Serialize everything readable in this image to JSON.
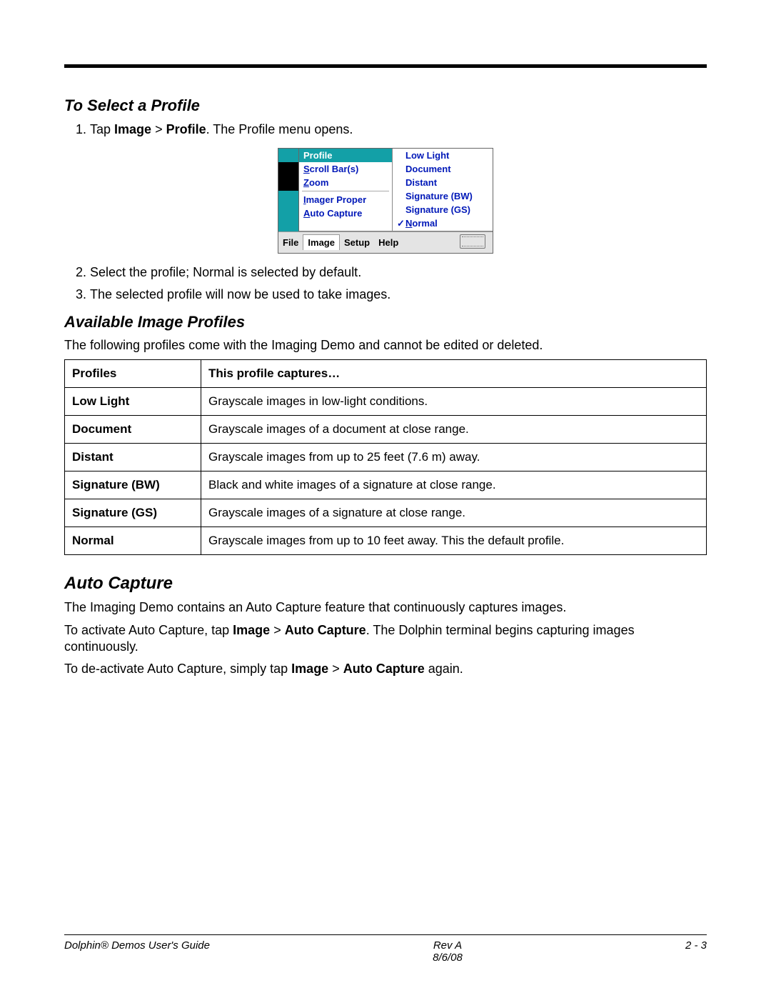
{
  "sections": {
    "select_profile": {
      "heading": "To Select a Profile",
      "step1_pre": "Tap ",
      "step1_b1": "Image",
      "step1_gt": " > ",
      "step1_b2": "Profile",
      "step1_post": ". The Profile menu opens.",
      "step2": "Select the profile; Normal is selected by default.",
      "step3": "The selected profile will now be used to take images."
    },
    "available_profiles": {
      "heading": "Available Image Profiles",
      "intro": "The following profiles come with the Imaging Demo and cannot be edited or deleted."
    },
    "auto_capture": {
      "heading": "Auto Capture",
      "p1": "The Imaging Demo contains an Auto Capture feature that continuously captures images.",
      "p2_a": "To activate Auto Capture, tap ",
      "p2_b1": "Image",
      "p2_gt": " > ",
      "p2_b2": "Auto Capture",
      "p2_c": ". The Dolphin terminal begins capturing images continuously.",
      "p3_a": "To de-activate Auto Capture, simply tap ",
      "p3_b1": "Image",
      "p3_gt": " > ",
      "p3_b2": "Auto Capture",
      "p3_c": " again."
    }
  },
  "screenshot": {
    "left_menu": {
      "header": "Profile",
      "items": [
        {
          "pre": "",
          "ul": "S",
          "post": "croll Bar(s)"
        },
        {
          "pre": "",
          "ul": "Z",
          "post": "oom"
        }
      ],
      "items2": [
        {
          "pre": "",
          "ul": "I",
          "post": "mager Proper"
        },
        {
          "pre": "",
          "ul": "A",
          "post": "uto Capture"
        }
      ]
    },
    "right_menu": {
      "items": [
        {
          "label": "Low Light",
          "checked": false
        },
        {
          "label": "Document",
          "checked": false
        },
        {
          "label": "Distant",
          "checked": false
        },
        {
          "label": "Signature (BW)",
          "checked": false
        },
        {
          "label": "Signature (GS)",
          "checked": false
        }
      ],
      "normal_pre": "",
      "normal_ul": "N",
      "normal_post": "ormal"
    },
    "taskbar": {
      "file": "File",
      "image": "Image",
      "setup": "Setup",
      "help": "Help"
    }
  },
  "table": {
    "h1": "Profiles",
    "h2": "This profile captures…",
    "rows": [
      {
        "name": "Low Light",
        "desc": "Grayscale images in low-light conditions."
      },
      {
        "name": "Document",
        "desc": "Grayscale images of a document at close range."
      },
      {
        "name": "Distant",
        "desc": "Grayscale images from up to 25 feet (7.6 m) away."
      },
      {
        "name": "Signature (BW)",
        "desc": "Black and white images of a signature at close range."
      },
      {
        "name": "Signature (GS)",
        "desc": "Grayscale images of a signature at close range."
      },
      {
        "name": "Normal",
        "desc": "Grayscale images from up to 10 feet away. This the default profile."
      }
    ]
  },
  "footer": {
    "left": "Dolphin® Demos User's Guide",
    "center1": "Rev A",
    "center2": "8/6/08",
    "right": "2 - 3"
  }
}
